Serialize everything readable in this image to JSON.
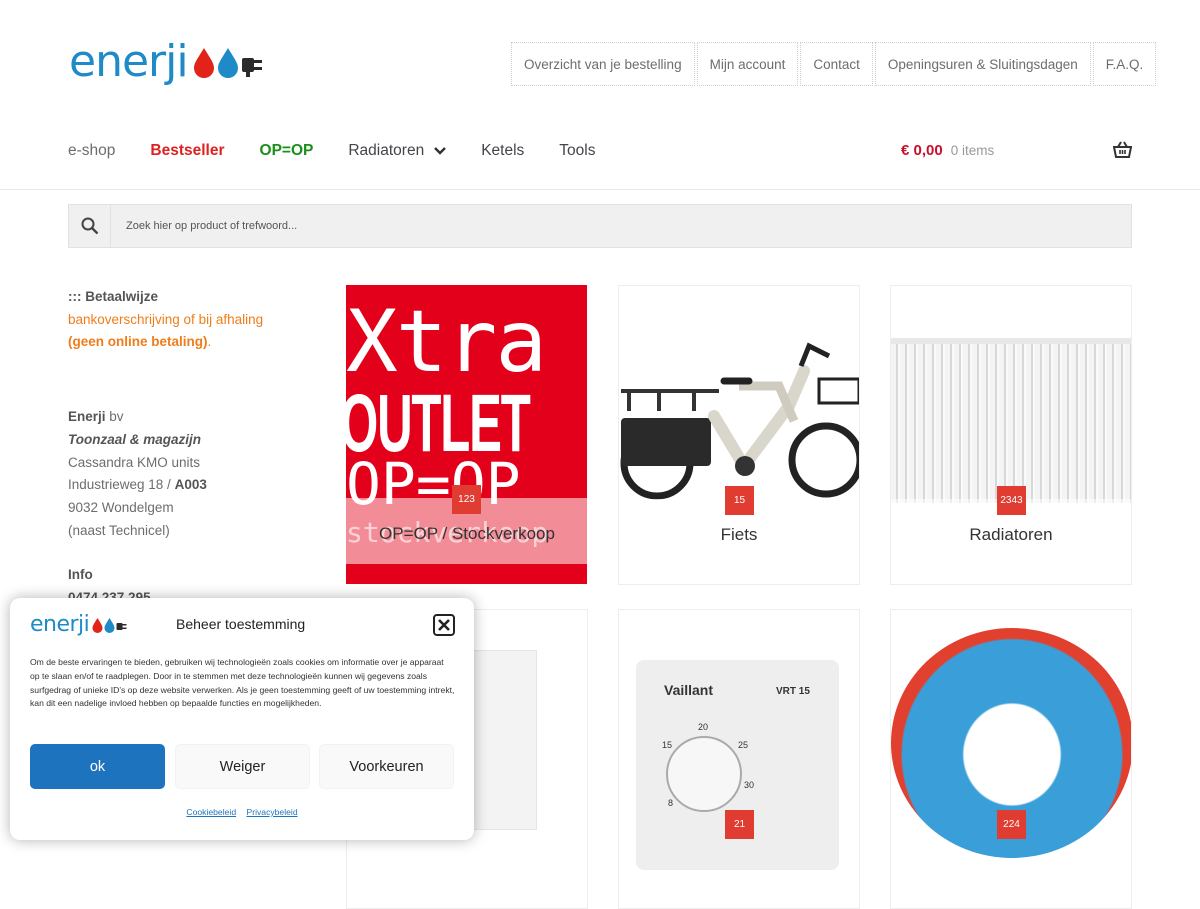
{
  "header": {
    "logo_text": "enerji",
    "top_nav": [
      "Overzicht van je bestelling",
      "Mijn account",
      "Contact",
      "Openingsuren & Sluitingsdagen",
      "F.A.Q."
    ],
    "main_nav": {
      "eshop": "e-shop",
      "bestseller": "Bestseller",
      "opop": "OP=OP",
      "radiatoren": "Radiatoren",
      "ketels": "Ketels",
      "tools": "Tools"
    },
    "cart": {
      "amount": "€ 0,00",
      "items": "0 items"
    }
  },
  "search": {
    "placeholder": "Zoek hier op product of trefwoord..."
  },
  "sidebar": {
    "payment_title": "::: Betaalwijze",
    "payment_line1": "bankoverschrijving of bij afhaling",
    "payment_line2_bold": "(geen online betaling)",
    "payment_line2_end": ".",
    "company_name": "Enerji",
    "company_suffix": " bv",
    "showroom": "Toonzaal & magazijn",
    "addr1": "Cassandra KMO units",
    "addr2": "Industrieweg 18 / ",
    "addr2_bold": "A003",
    "addr3": "9032 Wondelgem",
    "addr4": "(naast Technicel)",
    "info_title": "Info",
    "phone": "0474 237 295"
  },
  "products": [
    {
      "title": "OP=OP / Stockverkoop",
      "count": "123",
      "image_text1": "Xtra",
      "image_text2": "OUTLET",
      "image_text3": "OP=OP",
      "image_text4": "stockverkoop"
    },
    {
      "title": "Fiets",
      "count": "15"
    },
    {
      "title": "Radiatoren",
      "count": "2343"
    },
    {
      "title": "",
      "count": ""
    },
    {
      "title": "",
      "count": "21",
      "brand": "Vaillant",
      "model": "VRT 15",
      "dial": [
        "15",
        "20",
        "25",
        "30",
        "8"
      ]
    },
    {
      "title": "",
      "count": "224"
    }
  ],
  "cookie_modal": {
    "logo_text": "enerji",
    "title": "Beheer toestemming",
    "body": "Om de beste ervaringen te bieden, gebruiken wij technologieën zoals cookies om informatie over je apparaat op te slaan en/of te raadplegen. Door in te stemmen met deze technologieën kunnen wij gegevens zoals surfgedrag of unieke ID's op deze website verwerken. Als je geen toestemming geeft of uw toestemming intrekt, kan dit een nadelige invloed hebben op bepaalde functies en mogelijkheden.",
    "btn_ok": "ok",
    "btn_deny": "Weiger",
    "btn_prefs": "Voorkeuren",
    "link_cookie": "Cookiebeleid",
    "link_privacy": "Privacybeleid"
  },
  "colors": {
    "brand_blue": "#1f8ac8",
    "accent_red": "#e03c31",
    "opop_green": "#1a8f1a",
    "orange": "#f07d19",
    "btn_blue": "#1e73be"
  }
}
